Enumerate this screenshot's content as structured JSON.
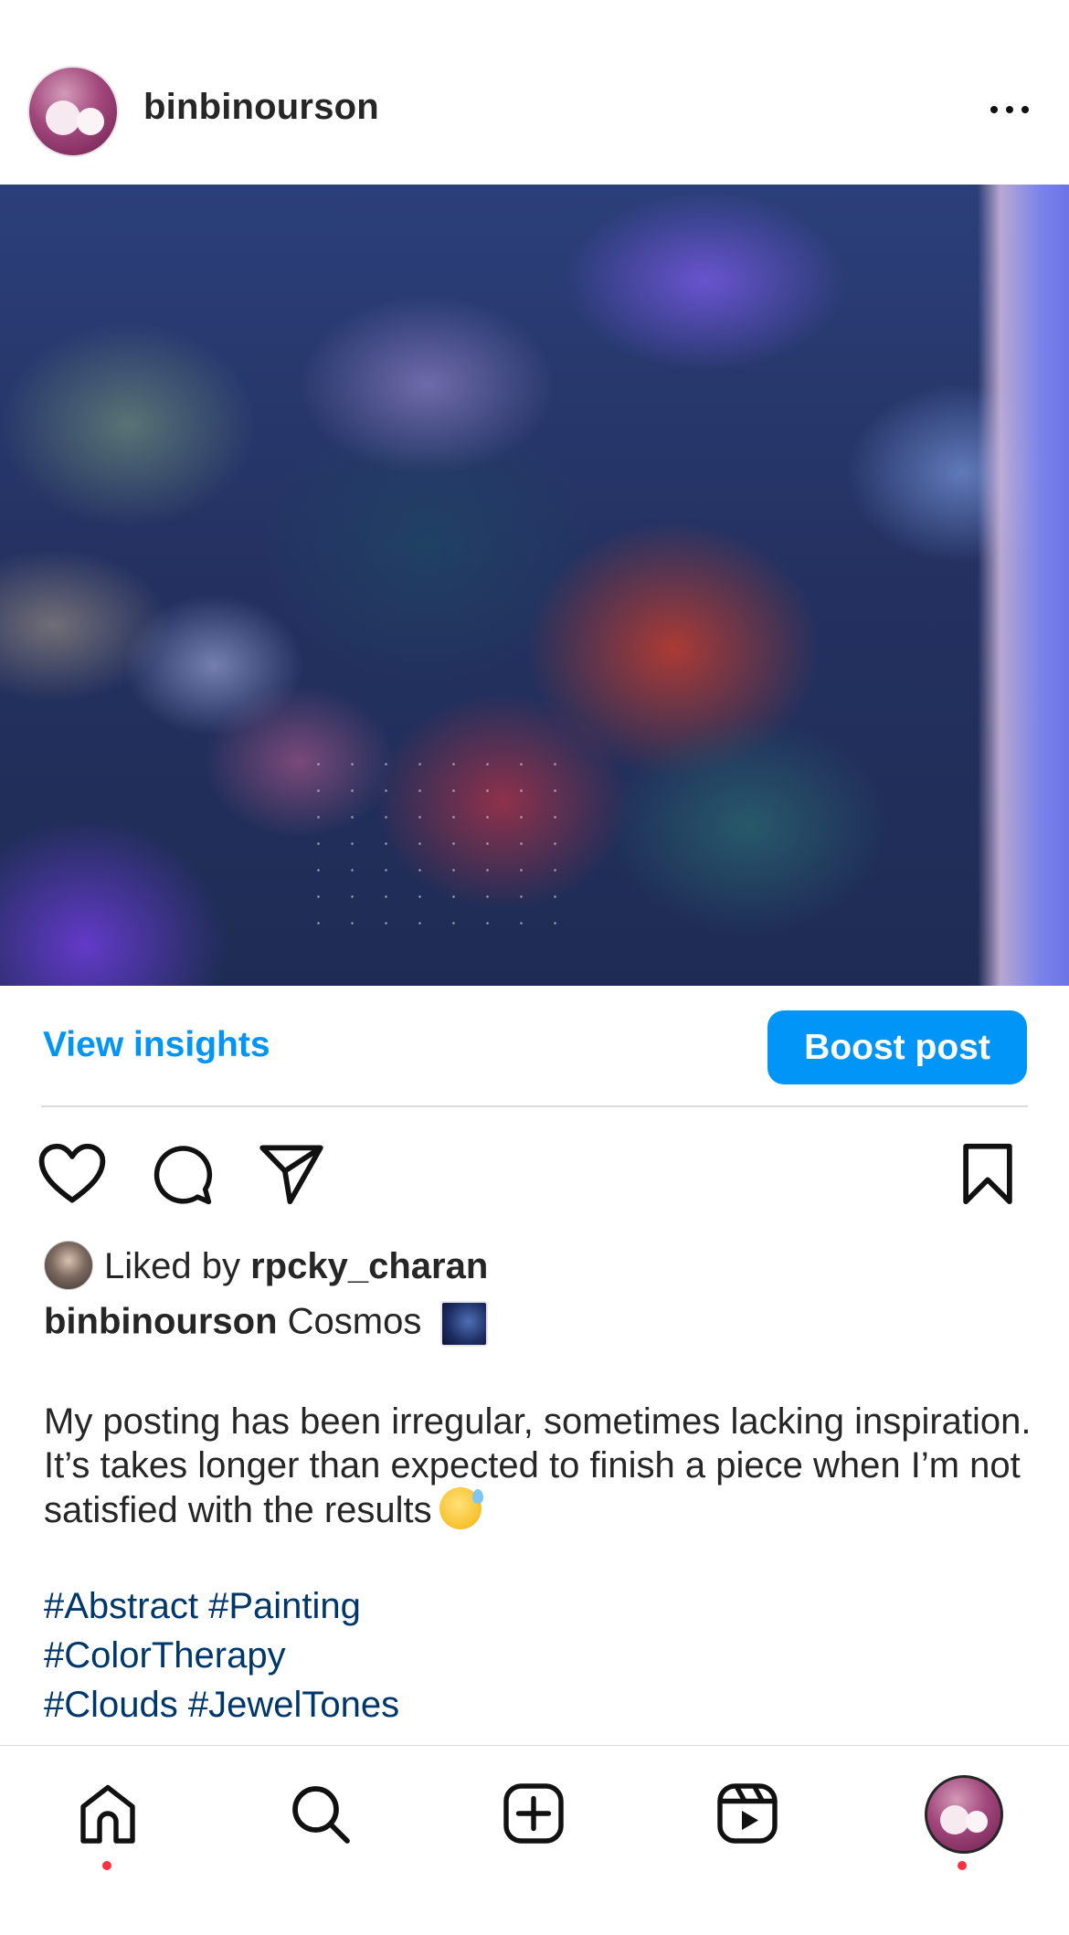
{
  "post": {
    "username": "binbinourson",
    "insights_label": "View insights",
    "boost_label": "Boost post",
    "liked_by_prefix": "Liked by ",
    "liked_by_user": "rpcky_charan",
    "caption_user": "binbinourson",
    "caption_title": "Cosmos",
    "caption_body": "My posting has been irregular, sometimes lacking inspiration. It’s takes longer than expected to finish a piece when I’m not satisfied with the results",
    "hashtag_lines": [
      "#Abstract #Painting",
      "#ColorTherapy",
      "#Clouds #JewelTones"
    ]
  },
  "icons": {
    "more": "more-horizontal-icon",
    "like": "heart-icon",
    "comment": "comment-bubble-icon",
    "share": "paper-plane-icon",
    "save": "bookmark-icon",
    "cosmos_emoji": "milky-way-emoji",
    "caption_emoji": "grinning-sweat-emoji"
  },
  "bottom_nav": {
    "items": [
      "home-icon",
      "search-icon",
      "create-icon",
      "reels-icon",
      "profile-avatar"
    ]
  },
  "colors": {
    "accent": "#0095f6",
    "hashtag": "#00376b",
    "notification_dot": "#ff3040"
  }
}
